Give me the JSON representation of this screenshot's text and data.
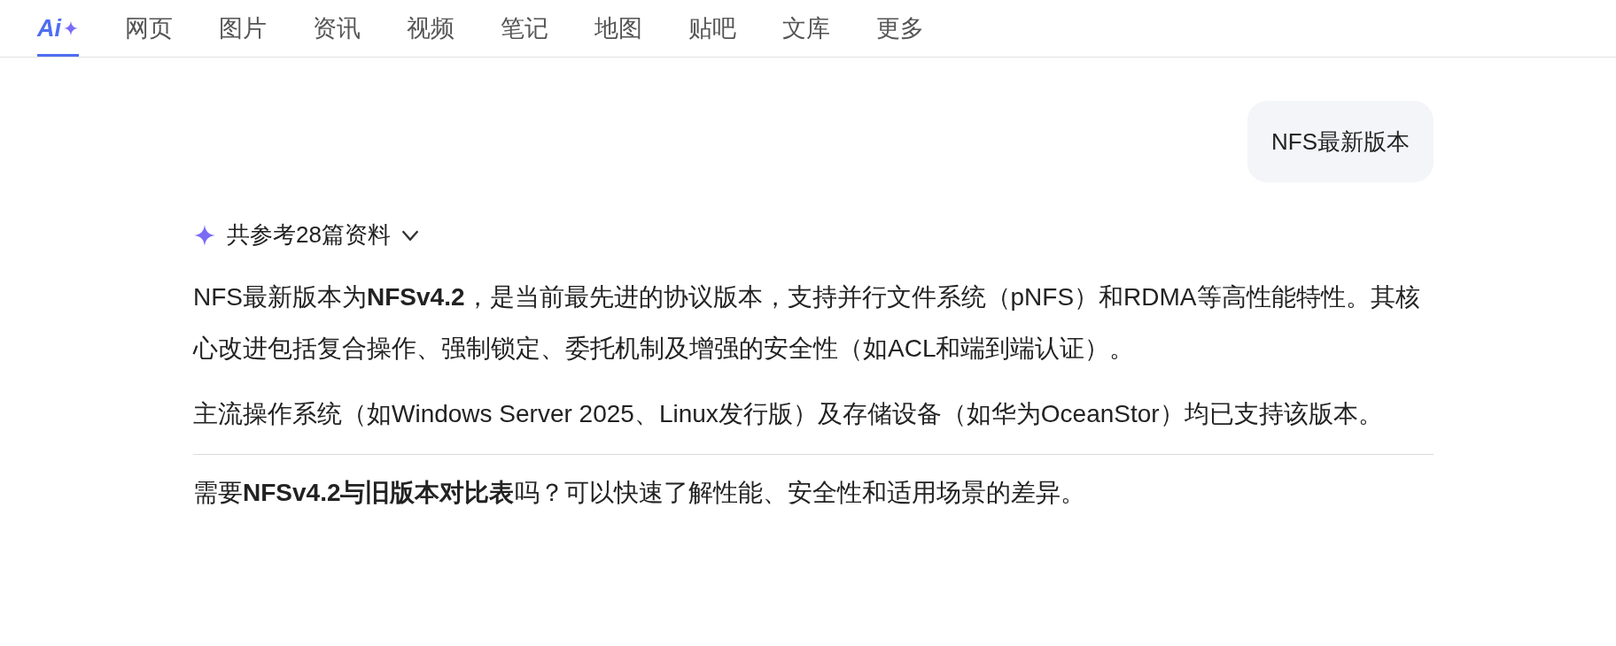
{
  "tabs": [
    {
      "kind": "logo",
      "label": "Ai",
      "selected": true
    },
    {
      "kind": "text",
      "label": "网页",
      "selected": false
    },
    {
      "kind": "text",
      "label": "图片",
      "selected": false
    },
    {
      "kind": "text",
      "label": "资讯",
      "selected": false
    },
    {
      "kind": "text",
      "label": "视频",
      "selected": false
    },
    {
      "kind": "text",
      "label": "笔记",
      "selected": false
    },
    {
      "kind": "text",
      "label": "地图",
      "selected": false
    },
    {
      "kind": "text",
      "label": "贴吧",
      "selected": false
    },
    {
      "kind": "text",
      "label": "文库",
      "selected": false
    },
    {
      "kind": "text",
      "label": "更多",
      "selected": false
    }
  ],
  "user_message": "NFS最新版本",
  "sources": {
    "label": "共参考28篇资料",
    "expanded": false
  },
  "answer_paragraphs": [
    "NFS最新版本为**NFSv4.2**，是当前最先进的协议版本，支持并行文件系统（pNFS）和RDMA等高性能特性。其核心改进包括复合操作、强制锁定、委托机制及增强的安全性（如ACL和端到端认证）。",
    "主流操作系统（如Windows Server 2025、Linux发行版）及存储设备（如华为OceanStor）均已支持该版本。"
  ],
  "follow_up": "需要**NFSv4.2与旧版本对比表**吗？可以快速了解性能、安全性和适用场景的差异。"
}
